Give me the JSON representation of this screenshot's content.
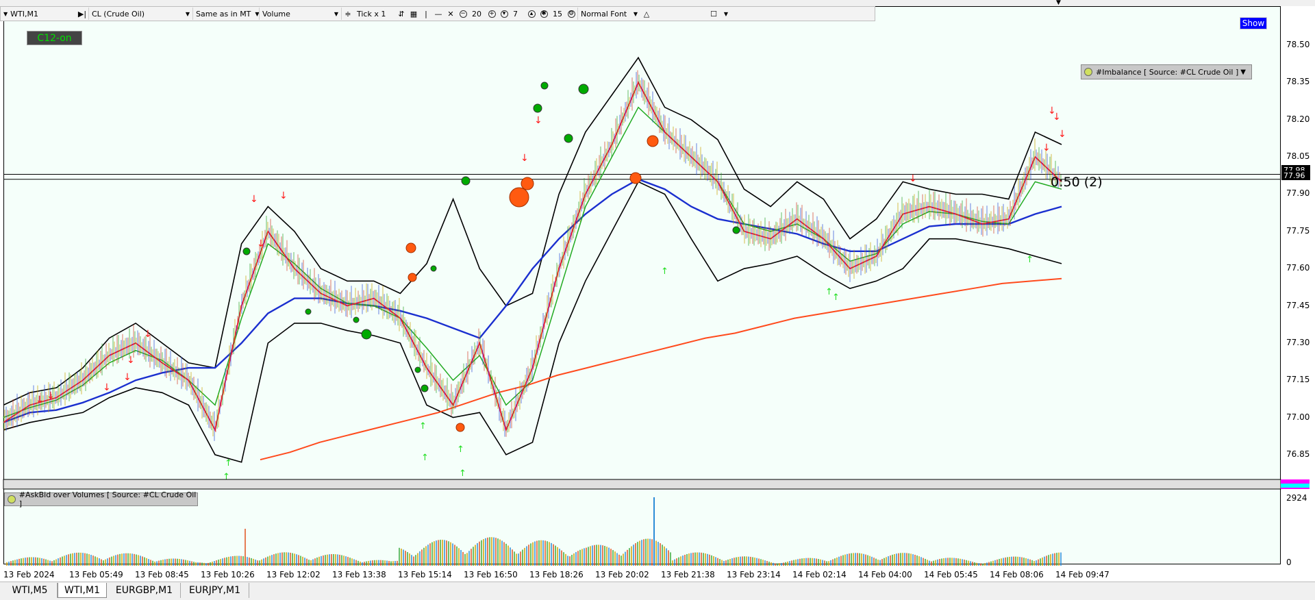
{
  "toolbar": {
    "window_label": "WTI,M1",
    "symbol_select": "CL (Crude Oil)",
    "mode_select": "Same as in MT",
    "data_select": "Volume",
    "tick_label": "Tick x 1",
    "value_1": "20",
    "value_2": "7",
    "value_3": "15",
    "font_select": "Normal Font"
  },
  "badge_label": "C12-on",
  "show_button": "Show",
  "imbalance_label": "#Imbalance [ Source: #CL Crude Oil ]",
  "volume_label": "#AskBid over Volumes [ Source: #CL Crude Oil ]",
  "countdown": "0:50 (2)",
  "price_axis": [
    "78.50",
    "78.35",
    "78.20",
    "78.05",
    "77.90",
    "77.75",
    "77.60",
    "77.45",
    "77.30",
    "77.15",
    "77.00",
    "76.85"
  ],
  "price_tags": [
    "77.98",
    "77.96"
  ],
  "volume_axis": [
    "2924",
    "0"
  ],
  "time_axis": [
    "13 Feb 2024",
    "13 Feb 05:49",
    "13 Feb 08:45",
    "13 Feb 10:26",
    "13 Feb 12:02",
    "13 Feb 13:38",
    "13 Feb 15:14",
    "13 Feb 16:50",
    "13 Feb 18:26",
    "13 Feb 20:02",
    "13 Feb 21:38",
    "13 Feb 23:14",
    "14 Feb 02:14",
    "14 Feb 04:00",
    "14 Feb 05:45",
    "14 Feb 08:06",
    "14 Feb 09:47"
  ],
  "tabs": [
    {
      "label": "WTI,M5",
      "active": false
    },
    {
      "label": "WTI,M1",
      "active": true
    },
    {
      "label": "EURGBP,M1",
      "active": false
    },
    {
      "label": "EURJPY,M1",
      "active": false
    }
  ],
  "colors": {
    "chart_bg": "#f5fffa",
    "bollinger": "#000000",
    "ma_fast": "#ff0033",
    "ma_mid": "#22aa22",
    "ma_slow": "#1a2fcf",
    "ma_long": "#ff4a1c",
    "show_button_bg": "#0000ff",
    "badge_text": "#00e000"
  },
  "chart_data": {
    "type": "line",
    "title": "",
    "y_range": [
      76.8,
      78.55
    ],
    "series": [
      {
        "values": [
          76.98,
          77.05,
          77.08,
          77.15,
          77.25,
          77.3,
          77.22,
          77.15,
          76.95,
          77.45,
          77.75,
          77.6,
          77.5,
          77.45,
          77.48,
          77.4,
          77.2,
          77.05,
          77.3,
          76.95,
          77.2,
          77.6,
          77.9,
          78.1,
          78.35,
          78.15,
          78.05,
          77.95,
          77.75,
          77.72,
          77.8,
          77.72,
          77.6,
          77.65,
          77.82,
          77.85,
          77.82,
          77.78,
          77.8,
          78.05,
          77.95
        ]
      },
      {
        "values": [
          77.0,
          77.04,
          77.07,
          77.13,
          77.22,
          77.27,
          77.23,
          77.15,
          77.05,
          77.4,
          77.7,
          77.62,
          77.52,
          77.46,
          77.45,
          77.4,
          77.28,
          77.15,
          77.25,
          77.05,
          77.15,
          77.5,
          77.85,
          78.05,
          78.25,
          78.15,
          78.05,
          77.95,
          77.78,
          77.75,
          77.78,
          77.72,
          77.63,
          77.66,
          77.78,
          77.83,
          77.82,
          77.79,
          77.78,
          77.95,
          77.92
        ]
      },
      {
        "values": [
          76.98,
          77.02,
          77.03,
          77.06,
          77.1,
          77.15,
          77.18,
          77.2,
          77.2,
          77.3,
          77.42,
          77.48,
          77.48,
          77.46,
          77.45,
          77.43,
          77.4,
          77.36,
          77.32,
          77.45,
          77.6,
          77.72,
          77.82,
          77.9,
          77.96,
          77.92,
          77.85,
          77.8,
          77.78,
          77.76,
          77.74,
          77.7,
          77.67,
          77.67,
          77.72,
          77.77,
          77.78,
          77.78,
          77.78,
          77.82,
          77.85
        ]
      },
      {
        "values": [
          76.83,
          76.86,
          76.9,
          76.93,
          76.96,
          76.99,
          77.02,
          77.06,
          77.1,
          77.13,
          77.17,
          77.2,
          77.23,
          77.26,
          77.29,
          77.32,
          77.34,
          77.37,
          77.4,
          77.42,
          77.44,
          77.46,
          77.48,
          77.5,
          77.52,
          77.54,
          77.55,
          77.56
        ]
      }
    ]
  }
}
